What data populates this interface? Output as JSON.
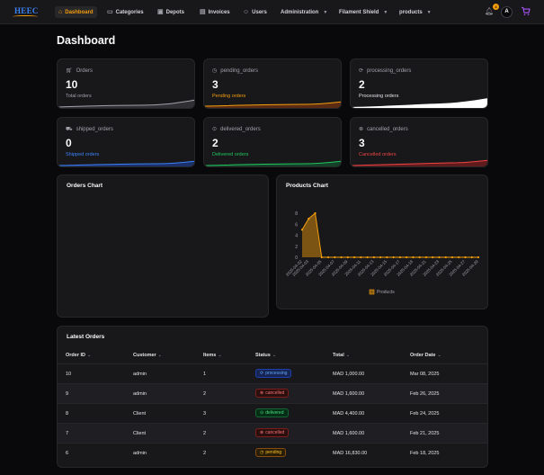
{
  "brand": {
    "logo_text": "HEEC"
  },
  "nav": {
    "items": [
      {
        "label": "Dashboard",
        "icon": "home-icon"
      },
      {
        "label": "Categories",
        "icon": "folder-icon"
      },
      {
        "label": "Depots",
        "icon": "building-icon"
      },
      {
        "label": "Invoices",
        "icon": "document-icon"
      },
      {
        "label": "Users",
        "icon": "users-icon"
      },
      {
        "label": "Administration"
      },
      {
        "label": "Filament Shield"
      },
      {
        "label": "products"
      }
    ],
    "notification_count": "4",
    "avatar_initial": "A"
  },
  "page": {
    "title": "Dashboard"
  },
  "stats": [
    {
      "title": "Orders",
      "value": "10",
      "desc": "Total orders",
      "color": "#a1a1aa"
    },
    {
      "title": "pending_orders",
      "value": "3",
      "desc": "Pending orders",
      "color": "#f59e0b"
    },
    {
      "title": "processing_orders",
      "value": "2",
      "desc": "Processing orders",
      "color": "#ffffff"
    },
    {
      "title": "shipped_orders",
      "value": "0",
      "desc": "Shipped orders",
      "color": "#3b82f6"
    },
    {
      "title": "delivered_orders",
      "value": "2",
      "desc": "Delivered orders",
      "color": "#22c55e"
    },
    {
      "title": "cancelled_orders",
      "value": "3",
      "desc": "Cancelled orders",
      "color": "#ef4444"
    }
  ],
  "orders_chart": {
    "title": "Orders Chart"
  },
  "products_chart": {
    "title": "Products Chart"
  },
  "chart_data": {
    "type": "area",
    "title": "Products Chart",
    "x": [
      "2025-04-02",
      "2025-04-03",
      "2025-04-04",
      "2025-04-05",
      "2025-04-06",
      "2025-04-07",
      "2025-04-08",
      "2025-04-09",
      "2025-04-10",
      "2025-04-11",
      "2025-04-12",
      "2025-04-13",
      "2025-04-14",
      "2025-04-15",
      "2025-04-16",
      "2025-04-17",
      "2025-04-18",
      "2025-04-19",
      "2025-04-20",
      "2025-04-21",
      "2025-04-22",
      "2025-04-23",
      "2025-04-24",
      "2025-04-25",
      "2025-04-26",
      "2025-04-27",
      "2025-04-28",
      "2025-04-29"
    ],
    "x_tick_labels": [
      "2025-04-02",
      "2025-04-03",
      "2025-04-05",
      "2025-04-07",
      "2025-04-09",
      "2025-04-11",
      "2025-04-13",
      "2025-04-15",
      "2025-04-17",
      "2025-04-19",
      "2025-04-21",
      "2025-04-23",
      "2025-04-25",
      "2025-04-27",
      "2025-04-29"
    ],
    "series": [
      {
        "name": "Products",
        "values": [
          5,
          7,
          8,
          0,
          0,
          0,
          0,
          0,
          0,
          0,
          0,
          0,
          0,
          0,
          0,
          0,
          0,
          0,
          0,
          0,
          0,
          0,
          0,
          0,
          0,
          0,
          0,
          0
        ],
        "color": "#f59e0b"
      }
    ],
    "ylim": [
      0,
      8
    ],
    "y_ticks": [
      0,
      2,
      4,
      6,
      8
    ],
    "legend_position": "bottom",
    "grid": false
  },
  "latest_orders": {
    "title": "Latest Orders",
    "columns": [
      "Order ID",
      "Customer",
      "Items",
      "Status",
      "Total",
      "Order Date"
    ],
    "rows": [
      {
        "id": "10",
        "customer": "admin",
        "items": "1",
        "status": "processing",
        "total": "MAD 1,000.00",
        "date": "Mar 08, 2025"
      },
      {
        "id": "9",
        "customer": "admin",
        "items": "2",
        "status": "cancelled",
        "total": "MAD 1,600.00",
        "date": "Feb 26, 2025"
      },
      {
        "id": "8",
        "customer": "Client",
        "items": "3",
        "status": "delivered",
        "total": "MAD 4,400.00",
        "date": "Feb 24, 2025"
      },
      {
        "id": "7",
        "customer": "Client",
        "items": "2",
        "status": "cancelled",
        "total": "MAD 1,600.00",
        "date": "Feb 21, 2025"
      },
      {
        "id": "6",
        "customer": "admin",
        "items": "2",
        "status": "pending",
        "total": "MAD 16,830.00",
        "date": "Feb 18, 2025"
      }
    ]
  }
}
